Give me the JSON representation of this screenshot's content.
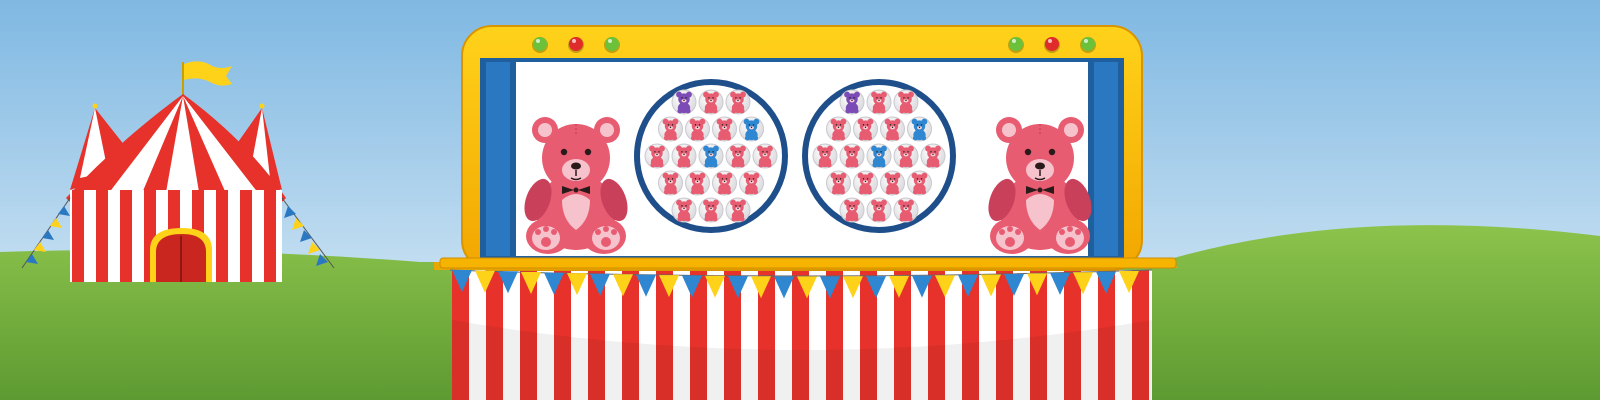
{
  "scene": {
    "colors": {
      "sky_top": "#7fb8e2",
      "sky_bottom": "#dcecf7",
      "grass": "#6aa63a",
      "grass_light": "#8cc34c",
      "booth_frame": "#f6b400",
      "booth_frame_dark": "#d89500",
      "panel_blue": "#2a78c2",
      "panel_white": "#ffffff",
      "stripe_red": "#e6322b",
      "stripe_white": "#ffffff",
      "bear_pink": "#e85c72",
      "bear_pink_dark": "#c8405a",
      "bear_purple": "#7d4bb5",
      "bear_blue": "#2f86d1"
    },
    "tent": {
      "icon": "circus-tent-icon",
      "flag_icon": "flag-icon"
    },
    "booth": {
      "lights_left": [
        "green",
        "red",
        "green"
      ],
      "lights_right": [
        "green",
        "red",
        "green"
      ],
      "bunting_colors": [
        "blue",
        "yellow"
      ]
    },
    "prizes": {
      "left": {
        "icon": "teddy-bear-icon",
        "color": "pink"
      },
      "right": {
        "icon": "teddy-bear-icon",
        "color": "pink"
      }
    },
    "target_boards": [
      {
        "rows": [
          [
            "purple",
            "pink",
            "pink"
          ],
          [
            "pink",
            "pink",
            "pink",
            "blue"
          ],
          [
            "pink",
            "pink",
            "blue",
            "pink",
            "pink"
          ],
          [
            "pink",
            "pink",
            "pink",
            "pink"
          ],
          [
            "pink",
            "pink",
            "pink"
          ]
        ]
      },
      {
        "rows": [
          [
            "purple",
            "pink",
            "pink"
          ],
          [
            "pink",
            "pink",
            "pink",
            "blue"
          ],
          [
            "pink",
            "pink",
            "blue",
            "pink",
            "pink"
          ],
          [
            "pink",
            "pink",
            "pink",
            "pink"
          ],
          [
            "pink",
            "pink",
            "pink"
          ]
        ]
      }
    ]
  }
}
